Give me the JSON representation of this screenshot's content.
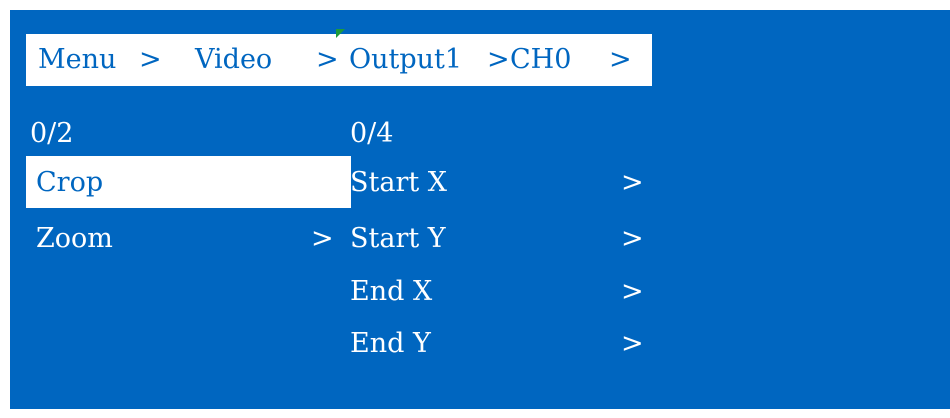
{
  "breadcrumb": {
    "items": [
      "Menu",
      "Video",
      "Output1",
      "CH0"
    ],
    "separator": ">",
    "trailing": ">"
  },
  "menu": {
    "counter": "0/2",
    "items": [
      {
        "label": "Crop",
        "arrow": ">",
        "selected": true
      },
      {
        "label": "Zoom",
        "arrow": ">",
        "selected": false
      }
    ]
  },
  "submenu": {
    "counter": "0/4",
    "items": [
      {
        "label": "Start X",
        "arrow": ">"
      },
      {
        "label": "Start Y",
        "arrow": ">"
      },
      {
        "label": "End X",
        "arrow": ">"
      },
      {
        "label": "End Y",
        "arrow": ">"
      }
    ]
  },
  "colors": {
    "background": "#0066c0",
    "highlight": "#ffffff",
    "text": "#ffffff",
    "cursor_mark": "#1e9a3a"
  }
}
